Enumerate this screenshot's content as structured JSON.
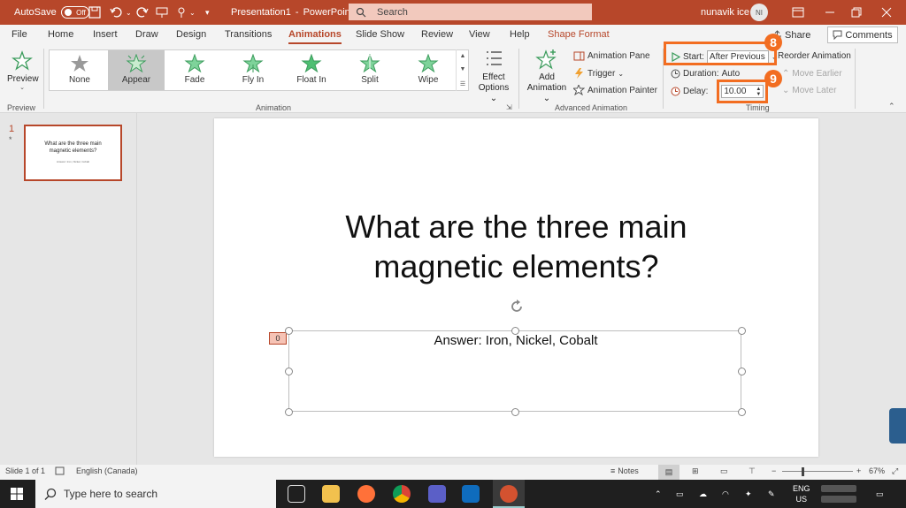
{
  "titlebar": {
    "autosave_label": "AutoSave",
    "autosave_state": "Off",
    "doc_title": "Presentation1",
    "separator": "-",
    "app_name": "PowerPoint",
    "search_placeholder": "Search",
    "user_name": "nunavik ice",
    "user_initials": "NI"
  },
  "tabs": [
    "File",
    "Home",
    "Insert",
    "Draw",
    "Design",
    "Transitions",
    "Animations",
    "Slide Show",
    "Review",
    "View",
    "Help",
    "Shape Format"
  ],
  "active_tab": "Animations",
  "share_label": "Share",
  "comments_label": "Comments",
  "ribbon": {
    "preview_label": "Preview",
    "preview_group": "Preview",
    "animation_group": "Animation",
    "animations": [
      "None",
      "Appear",
      "Fade",
      "Fly In",
      "Float In",
      "Split",
      "Wipe"
    ],
    "selected_animation": "Appear",
    "effect_options": [
      "Effect",
      "Options"
    ],
    "advanced_group": "Advanced Animation",
    "add_animation": [
      "Add",
      "Animation"
    ],
    "animation_pane": "Animation Pane",
    "trigger": "Trigger",
    "animation_painter": "Animation Painter",
    "timing_group": "Timing",
    "start_label": "Start:",
    "start_value": "After Previous",
    "duration_label": "Duration:",
    "duration_value": "Auto",
    "delay_label": "Delay:",
    "delay_value": "10.00",
    "reorder_label": "Reorder Animation",
    "move_earlier": "Move Earlier",
    "move_later": "Move Later",
    "callout_8": "8",
    "callout_9": "9"
  },
  "thumbnails": {
    "number": "1",
    "marker": "*",
    "title": "What are the three main magnetic elements?",
    "subtitle": "Answer: Iron, Nickel, Cobalt"
  },
  "slide": {
    "title_line1": "What are the three main",
    "title_line2": "magnetic elements?",
    "answer": "Answer: Iron, Nickel, Cobalt",
    "anim_order": "0"
  },
  "status": {
    "slide_count": "Slide 1 of 1",
    "language": "English (Canada)",
    "notes": "Notes",
    "zoom": "67%"
  },
  "taskbar": {
    "search_placeholder": "Type here to search",
    "lang": "ENG",
    "region": "US"
  }
}
